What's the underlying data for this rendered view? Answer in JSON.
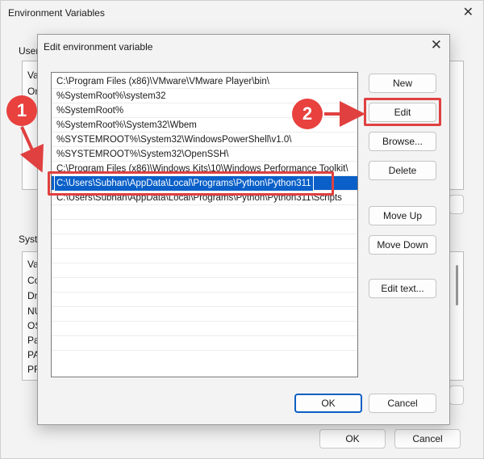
{
  "background_window": {
    "title": "Environment Variables",
    "user_group_label": "User",
    "user_rows": [
      "Va",
      "On"
    ],
    "system_group_label": "Syste",
    "system_rows": [
      "Va",
      "Co",
      "Dr",
      "NU",
      "OS",
      "Pa",
      "PA",
      "PR"
    ],
    "ok_label": "OK",
    "cancel_label": "Cancel"
  },
  "dialog": {
    "title": "Edit environment variable",
    "list_items": [
      "C:\\Program Files (x86)\\VMware\\VMware Player\\bin\\",
      "%SystemRoot%\\system32",
      "%SystemRoot%",
      "%SystemRoot%\\System32\\Wbem",
      "%SYSTEMROOT%\\System32\\WindowsPowerShell\\v1.0\\",
      "%SYSTEMROOT%\\System32\\OpenSSH\\",
      "C:\\Program Files (x86)\\Windows Kits\\10\\Windows Performance Toolkit\\",
      "C:\\Users\\Subhan\\AppData\\Local\\Programs\\Python\\Python311",
      "C:\\Users\\Subhan\\AppData\\Local\\Programs\\Python\\Python311\\Scripts"
    ],
    "selected_index": 7,
    "buttons": {
      "new": "New",
      "edit": "Edit",
      "browse": "Browse...",
      "delete": "Delete",
      "move_up": "Move Up",
      "move_down": "Move Down",
      "edit_text": "Edit text...",
      "ok": "OK",
      "cancel": "Cancel"
    }
  },
  "annotations": {
    "step1": "1",
    "step2": "2",
    "color": "#e04040"
  }
}
